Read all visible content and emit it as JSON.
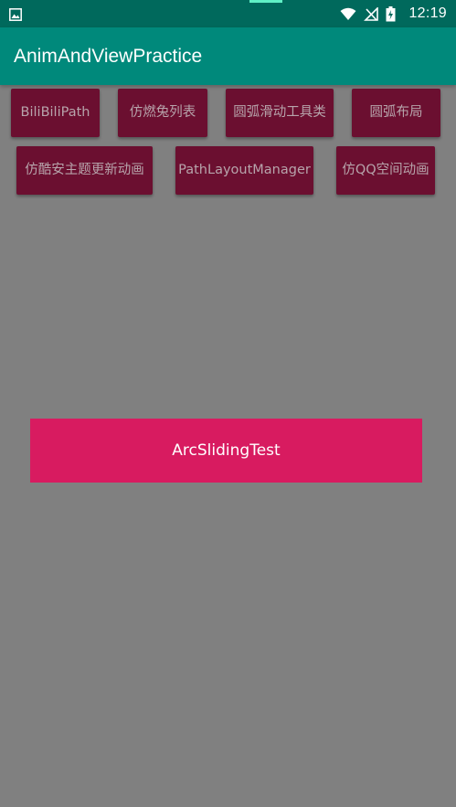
{
  "status_bar": {
    "left_icon": "image-notification-icon",
    "wifi_icon": "wifi-icon",
    "signal_icon": "no-signal-icon",
    "battery_icon": "battery-charging-icon",
    "time": "12:19",
    "background_color": "#00695c"
  },
  "app_bar": {
    "title": "AnimAndViewPractice",
    "background_color": "#00897b"
  },
  "buttons": [
    {
      "label": "BiliBiliPath"
    },
    {
      "label": "仿燃兔列表"
    },
    {
      "label": "圆弧滑动工具类"
    },
    {
      "label": "圆弧布局"
    },
    {
      "label": "仿酷安主题更新动画"
    },
    {
      "label": "PathLayoutManager"
    },
    {
      "label": "仿QQ空间动画"
    }
  ],
  "button_color": "#6b0f30",
  "main_button": {
    "label": "ArcSlidingTest",
    "color": "#d81b60"
  },
  "page_background": "#808080"
}
